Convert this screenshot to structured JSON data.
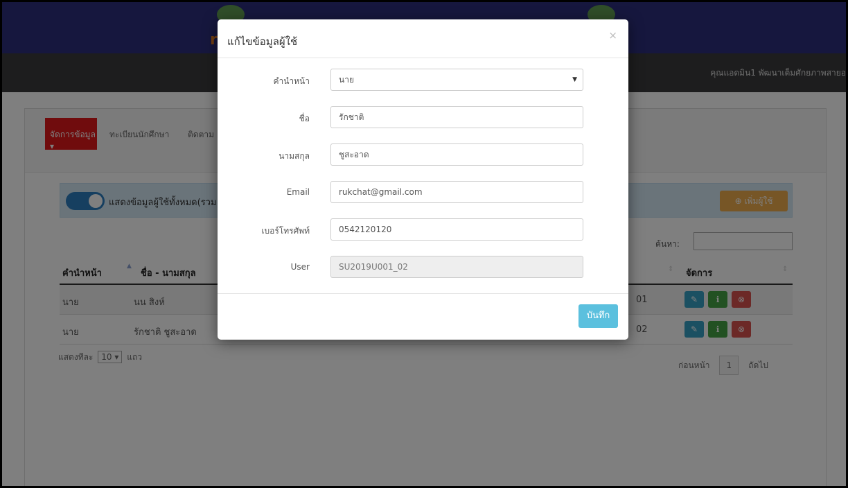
{
  "header": {
    "brand_letter": "r",
    "user_info": "คุณแอดมิน1 พัฒนาเต็มศักยภาพสายอ"
  },
  "tabs": {
    "active": "จัดการข้อมูล ▾",
    "items": [
      "ทะเบียนนักศึกษา",
      "ติดตาม"
    ]
  },
  "alert": {
    "text": "แสดงข้อมูลผู้ใช้ทั้งหมด(รวม",
    "add_user_label": "⊕ เพิ่มผู้ใช้"
  },
  "search": {
    "label": "ค้นหา:"
  },
  "table": {
    "columns": [
      "คำนำหน้า",
      "ชื่อ - นามสกุล",
      "จัดการ"
    ],
    "rows": [
      {
        "prefix": "นาย",
        "name": "นน สิงห์",
        "code": "01"
      },
      {
        "prefix": "นาย",
        "name": "รักชาติ ชูสะอาด",
        "code": "02"
      }
    ]
  },
  "footer": {
    "show_label": "แสดงทีละ",
    "page_size": "10",
    "rows_label": "แถว",
    "prev_label": "ก่อนหน้า",
    "page": "1",
    "next_label": "ถัดไป"
  },
  "modal": {
    "title": "แก้ไขข้อมูลผู้ใช้",
    "close": "×",
    "fields": {
      "prefix": {
        "label": "คำนำหน้า",
        "value": "นาย"
      },
      "first_name": {
        "label": "ชื่อ",
        "value": "รักชาติ"
      },
      "last_name": {
        "label": "นามสกุล",
        "value": "ชูสะอาด"
      },
      "email": {
        "label": "Email",
        "value": "rukchat@gmail.com"
      },
      "phone": {
        "label": "เบอร์โทรศัพท์",
        "value": "0542120120"
      },
      "user": {
        "label": "User",
        "value": "SU2019U001_02"
      }
    },
    "save_label": "บันทึก"
  },
  "colors": {
    "banner": "#2c2e7c",
    "navbar": "#3a3b3d",
    "active_tab": "#e0181b",
    "save_button": "#5bc0de",
    "add_user_button": "#efad4d"
  }
}
